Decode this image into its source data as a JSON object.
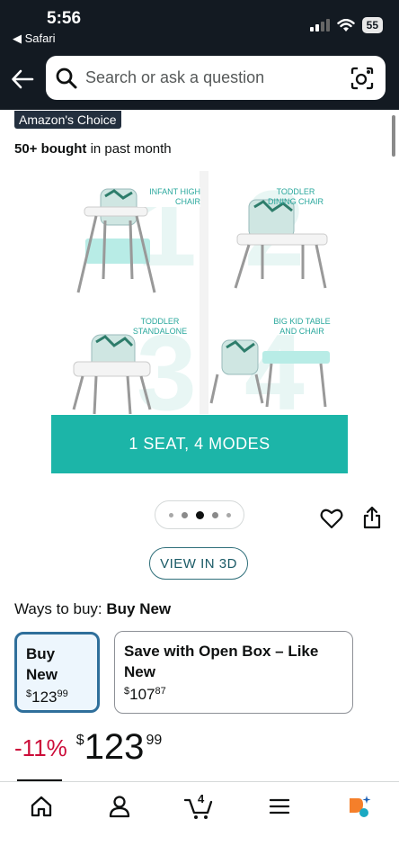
{
  "status_bar": {
    "time": "5:56",
    "back_app": "◀ Safari",
    "battery": "55"
  },
  "search": {
    "placeholder": "Search or ask a question"
  },
  "badge": {
    "label": "Amazon's Choice"
  },
  "bought": {
    "count": "50+ bought",
    "suffix": " in past month"
  },
  "product_image": {
    "modes": [
      {
        "label": "INFANT HIGH CHAIR"
      },
      {
        "label": "TODDLER DINING CHAIR"
      },
      {
        "label": "TODDLER STANDALONE"
      },
      {
        "label": "BIG KID TABLE AND CHAIR"
      }
    ],
    "banner": "1 SEAT, 4 MODES",
    "accent_color": "#1cb5a8"
  },
  "carousel": {
    "total": 5,
    "active_index": 2
  },
  "view_3d": {
    "label": "VIEW IN 3D"
  },
  "ways_to_buy": {
    "prefix": "Ways to buy: ",
    "selected": "Buy New",
    "options": [
      {
        "title": "Buy New",
        "currency": "$",
        "whole": "123",
        "fraction": "99",
        "selected": true
      },
      {
        "title": "Save with Open Box – Like New",
        "currency": "$",
        "whole": "107",
        "fraction": "87",
        "selected": false
      }
    ]
  },
  "price": {
    "discount": "-11%",
    "currency": "$",
    "whole": "123",
    "fraction": "99",
    "discount_color": "#cc0c39"
  },
  "bottom_nav": {
    "items": [
      {
        "name": "home-icon"
      },
      {
        "name": "account-icon"
      },
      {
        "name": "cart-icon",
        "count": "4"
      },
      {
        "name": "menu-icon"
      },
      {
        "name": "rufus-ai-icon"
      }
    ]
  }
}
